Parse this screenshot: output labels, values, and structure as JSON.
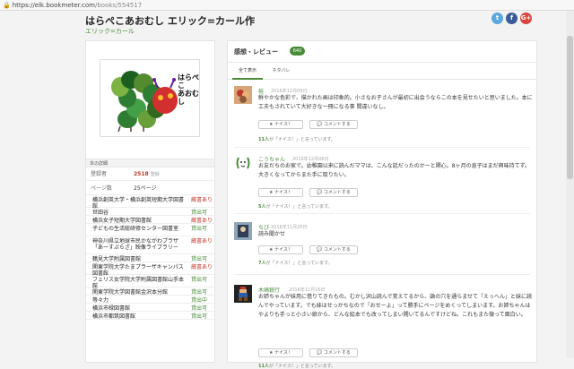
{
  "browser": {
    "url_host": "https://elk.bookmeter.com",
    "url_path": "/books/554517",
    "lock_icon": "lock-icon"
  },
  "book": {
    "title": "はらぺこあおむし エリック=カール作",
    "author": "エリック=カール",
    "cover_title": "はらぺこ\nあおむし"
  },
  "share": {
    "twitter": "t",
    "facebook": "f",
    "google": "G+"
  },
  "details": {
    "header": "本の詳細",
    "registrants_label": "登録者",
    "registrants_value": "2518",
    "registrants_unit": "登録",
    "pages_label": "ページ数",
    "pages_value": "25ページ"
  },
  "libraries": [
    {
      "name": "横浜創英大学・横浜創英短期大学図書館",
      "status": "蔵書あり",
      "kind": "ref"
    },
    {
      "name": "世田谷",
      "status": "貸出可",
      "kind": "lend"
    },
    {
      "name": "横浜女子短期大学図書館",
      "status": "蔵書あり",
      "kind": "ref"
    },
    {
      "name": "子どもの生活総研修センター図書室",
      "status": "貸出可",
      "kind": "lend"
    },
    {
      "name": "神奈川県立地球市民かながわプラザ「あーすぷらざ」映像ライブラリー",
      "status": "蔵書あり",
      "kind": "ref"
    },
    {
      "name": "鶴見大学附属図書館",
      "status": "貸出可",
      "kind": "lend"
    },
    {
      "name": "関東学院大学たまプラーザキャンパス図書館",
      "status": "蔵書あり",
      "kind": "ref"
    },
    {
      "name": "フェリス女学院大学附属図書館山手本館",
      "status": "貸出可",
      "kind": "lend"
    },
    {
      "name": "関東学院大学図書館金沢本分館",
      "status": "貸出可",
      "kind": "lend"
    },
    {
      "name": "等々力",
      "status": "貸出中",
      "kind": "lend"
    },
    {
      "name": "横浜市緑図書館",
      "status": "貸出可",
      "kind": "lend"
    },
    {
      "name": "横浜市都筑図書館",
      "status": "貸出可",
      "kind": "lend"
    }
  ],
  "reviews_section": {
    "label": "感想・レビュー",
    "count": "640",
    "tab_all": "全て表示",
    "tab_spoiler": "ネタバレ"
  },
  "nice_label": "★ ナイス！",
  "comment_label": "💬 コメントする",
  "reviews": [
    {
      "name": "裕",
      "date": "2016年12月09日",
      "text": "鮮やかな色彩で、描かれた画は印象的。小さなお子さんが最初に出会うならこの本を見せたいと思いました。本に工夫もされていて大好きな一冊になる事 間違いなし。",
      "nice_count": "11人",
      "foot_suffix": "が「ナイス！」と言っています。"
    },
    {
      "name": "こうちゃん",
      "date": "2016年12月06日",
      "text": "お友だちのお家で。幼稚園以来に読んだママは、こんな話だったのかーと関心。8ヶ月の息子はまだ興味持てず。大きくなってからまた手に取りたい。",
      "nice_count": "5人",
      "foot_suffix": "が「ナイス！」と言っています。"
    },
    {
      "name": "ちび",
      "date": "2016年11月25日",
      "text": "読み聞かせ",
      "nice_count": "7人",
      "foot_suffix": "が「ナイス！」と言っています。"
    },
    {
      "name": "木崎鋭行",
      "date": "2016年11月16日",
      "text": "お姉ちゃんが妹用に借りてきたもの。むかし沢山読んで覚えてるから、論の穴を通らませて「えっへん」と妹に読んでやっています。でも妹はせっかちなので「おせーよ」って勝手にページをめくってしまいます。お姉ちゃんはやよりも手っと小さい娘から、どんな絵本でも改ってしまい開いてるんですけどね。これもまた微って面白い。",
      "nice_count": "11人",
      "foot_suffix": "が「ナイス！」と言っています。"
    }
  ]
}
